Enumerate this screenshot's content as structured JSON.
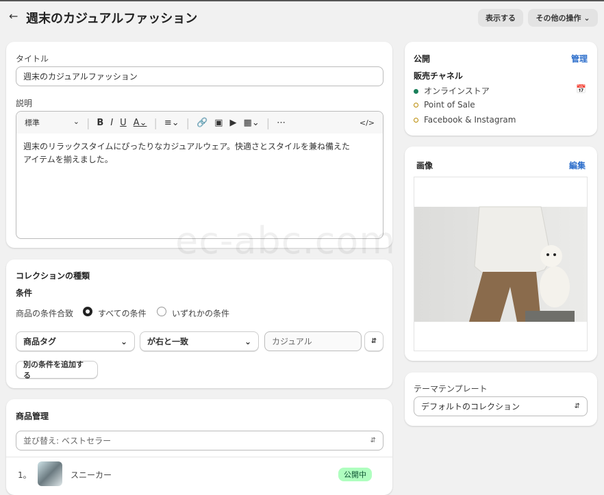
{
  "header": {
    "back_icon": "arrow-left-icon",
    "title": "週末のカジュアルファッション",
    "view_button": "表示する",
    "more_actions": "その他の操作"
  },
  "title_field": {
    "label": "タイトル",
    "value": "週末のカジュアルファッション"
  },
  "description": {
    "label": "説明",
    "format": "標準",
    "text_line1": "週末のリラックスタイムにぴったりなカジュアルウェア。快適さとスタイルを兼ね備えた",
    "text_line2": "アイテムを揃えました。"
  },
  "collection_type": {
    "heading": "コレクションの種類",
    "conditions_label": "条件",
    "match_label": "商品の条件合致",
    "options": [
      "すべての条件",
      "いずれかの条件"
    ],
    "selected": 0,
    "field": "商品タグ",
    "operator": "が右と一致",
    "value": "カジュアル",
    "add_condition": "別の条件を追加する"
  },
  "products": {
    "heading": "商品管理",
    "sort": "並び替え: ベストセラー",
    "items": [
      {
        "index": "1。",
        "name": "スニーカー",
        "status": "公開中"
      }
    ]
  },
  "publishing": {
    "heading": "公開",
    "manage": "管理",
    "channels_label": "販売チャネル",
    "channels": [
      {
        "name": "オンラインストア",
        "active": true
      },
      {
        "name": "Point of Sale",
        "active": false
      },
      {
        "name": "Facebook & Instagram",
        "active": false
      }
    ]
  },
  "image": {
    "heading": "画像",
    "edit": "編集"
  },
  "theme_template": {
    "label": "テーマテンプレート",
    "value": "デフォルトのコレクション"
  },
  "watermark": "ec-abc.com",
  "colors": {
    "active": "#1a7f5a",
    "inactive": "#b98900",
    "link": "#2c6ecb",
    "badge_bg": "#affebf"
  }
}
